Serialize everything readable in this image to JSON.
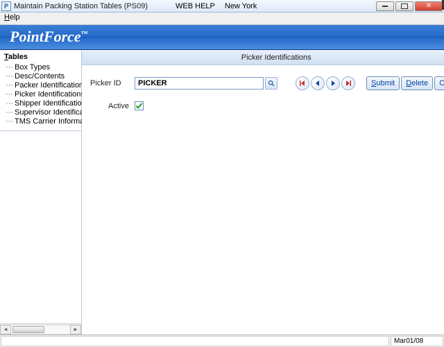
{
  "titlebar": {
    "icon_letter": "P",
    "title": "Maintain Packing Station Tables (PS09)",
    "webhelp": "WEB HELP",
    "location": "New York"
  },
  "menubar": {
    "help": "Help"
  },
  "brand": {
    "name": "PointForce",
    "tm": "™"
  },
  "sidebar": {
    "title": "Tables",
    "items": [
      {
        "label": "Box Types"
      },
      {
        "label": "Desc/Contents"
      },
      {
        "label": "Packer Identifications"
      },
      {
        "label": "Picker Identifications"
      },
      {
        "label": "Shipper Identifications"
      },
      {
        "label": "Supervisor Identifications"
      },
      {
        "label": "TMS Carrier Information"
      }
    ]
  },
  "content": {
    "header": "Picker Identifications",
    "picker_id_label": "Picker ID",
    "picker_id_value": "PICKER",
    "active_label": "Active",
    "active_checked": true
  },
  "buttons": {
    "submit": "Submit",
    "delete": "Delete",
    "clear": "Clear"
  },
  "nav_icons": {
    "first": "first-record-icon",
    "prev": "prev-record-icon",
    "next": "next-record-icon",
    "last": "last-record-icon"
  },
  "statusbar": {
    "date": "Mar01/08"
  }
}
